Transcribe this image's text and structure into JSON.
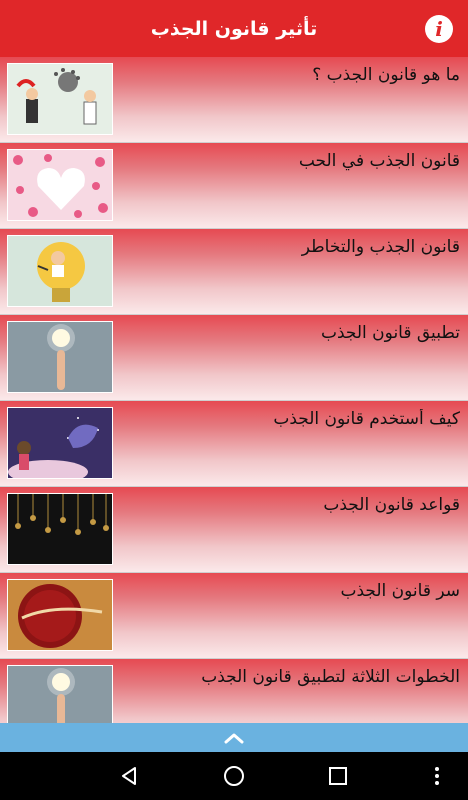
{
  "app_bar": {
    "title": "تأثير قانون الجذب",
    "info_label": "i"
  },
  "items": [
    {
      "title": "ما هو قانون الجذب ؟",
      "image": "businessmen-magnet-illustration"
    },
    {
      "title": "قانون الجذب في الحب",
      "image": "hearts-illustration"
    },
    {
      "title": "قانون الجذب والتخاطر",
      "image": "man-in-lightbulb-illustration"
    },
    {
      "title": "تطبيق قانون الجذب",
      "image": "finger-lightbulb-photo"
    },
    {
      "title": "كيف أستخدم قانون الجذب",
      "image": "girl-genie-illustration"
    },
    {
      "title": "قواعد قانون الجذب",
      "image": "hanging-keys-photo"
    },
    {
      "title": "سر قانون الجذب",
      "image": "the-secret-seal"
    },
    {
      "title": "الخطوات الثلاثة لتطبيق قانون الجذب",
      "image": "finger-lightbulb-photo"
    }
  ],
  "colors": {
    "app_bar": "#e02729",
    "row_top": "#e64a52",
    "scroll_bar": "#6ab2e0",
    "nav_bar": "#000000"
  },
  "icons": {
    "info": "info-icon",
    "scroll_up": "chevron-up-icon",
    "back": "back-triangle-icon",
    "home": "home-circle-icon",
    "recent": "recent-square-icon",
    "more": "more-dots-icon"
  }
}
